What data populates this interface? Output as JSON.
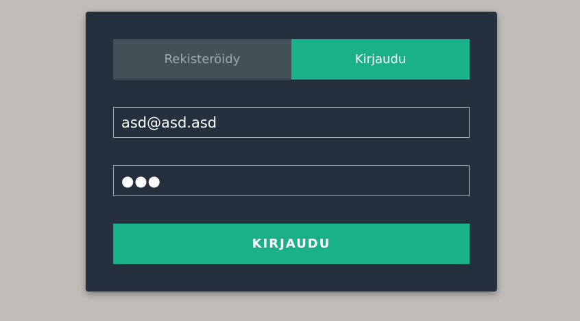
{
  "tabs": {
    "register_label": "Rekisteröidy",
    "login_label": "Kirjaudu",
    "active": "login"
  },
  "form": {
    "email_value": "asd@asd.asd",
    "password_masked": "●●●",
    "submit_label": "KIRJAUDU"
  },
  "colors": {
    "background": "#c0bcb9",
    "card": "#24303e",
    "accent": "#1ab188",
    "inactive_tab": "#435058",
    "inactive_tab_text": "#a0aaae",
    "field_border": "#a0b3b0"
  }
}
